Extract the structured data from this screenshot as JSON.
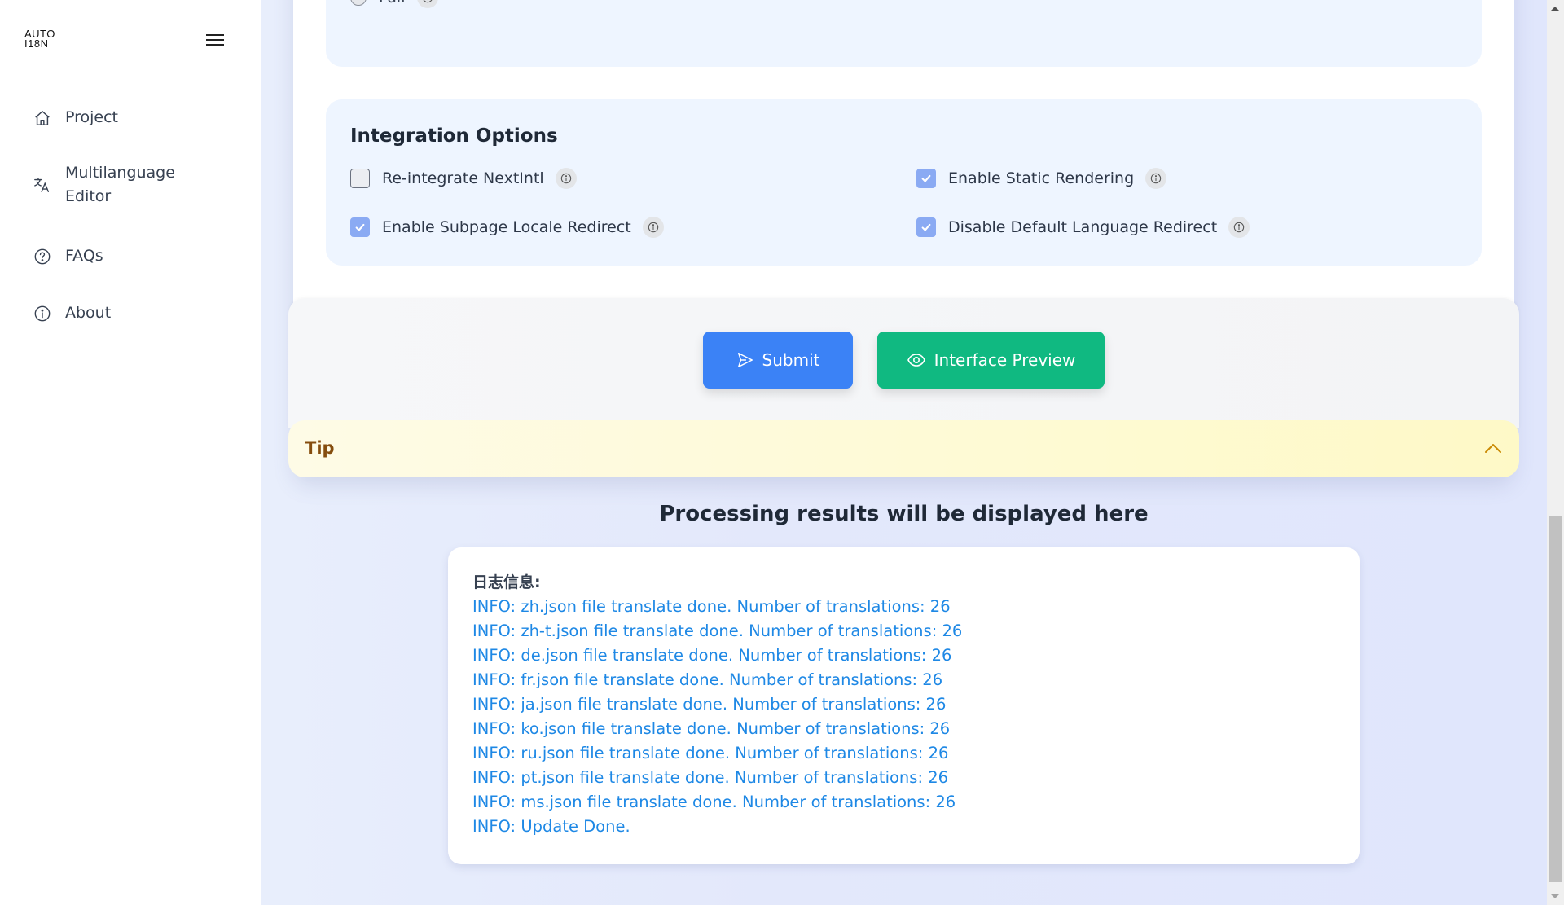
{
  "sidebar": {
    "logo_line1": "AUTO",
    "logo_line2": "I18N",
    "menu_icon": "hamburger-icon",
    "items": [
      {
        "label": "Project",
        "icon": "home-icon"
      },
      {
        "label": "Multilanguage Editor",
        "icon": "translate-icon"
      },
      {
        "label": "FAQs",
        "icon": "question-circle-icon"
      },
      {
        "label": "About",
        "icon": "info-circle-icon"
      }
    ]
  },
  "translation_mode": {
    "options": [
      {
        "label": "",
        "selected": true
      },
      {
        "label": "Full",
        "selected": false
      }
    ]
  },
  "integration": {
    "title": "Integration Options",
    "options": [
      {
        "label": "Re-integrate NextIntl",
        "checked": false
      },
      {
        "label": "Enable Static Rendering",
        "checked": true
      },
      {
        "label": "Enable Subpage Locale Redirect",
        "checked": true
      },
      {
        "label": "Disable Default Language Redirect",
        "checked": true
      }
    ]
  },
  "actions": {
    "submit_label": "Submit",
    "preview_label": "Interface Preview",
    "submit_color": "#3b82f6",
    "preview_color": "#10b981"
  },
  "tip": {
    "label": "Tip",
    "expanded": true
  },
  "results": {
    "heading": "Processing results will be displayed here",
    "log_title": "日志信息:",
    "log_lines": [
      "INFO: zh.json file translate done. Number of translations: 26",
      "INFO: zh-t.json file translate done. Number of translations: 26",
      "INFO: de.json file translate done. Number of translations: 26",
      "INFO: fr.json file translate done. Number of translations: 26",
      "INFO: ja.json file translate done. Number of translations: 26",
      "INFO: ko.json file translate done. Number of translations: 26",
      "INFO: ru.json file translate done. Number of translations: 26",
      "INFO: pt.json file translate done. Number of translations: 26",
      "INFO: ms.json file translate done. Number of translations: 26",
      "INFO: Update Done."
    ],
    "log_color": "#1e88e5"
  }
}
